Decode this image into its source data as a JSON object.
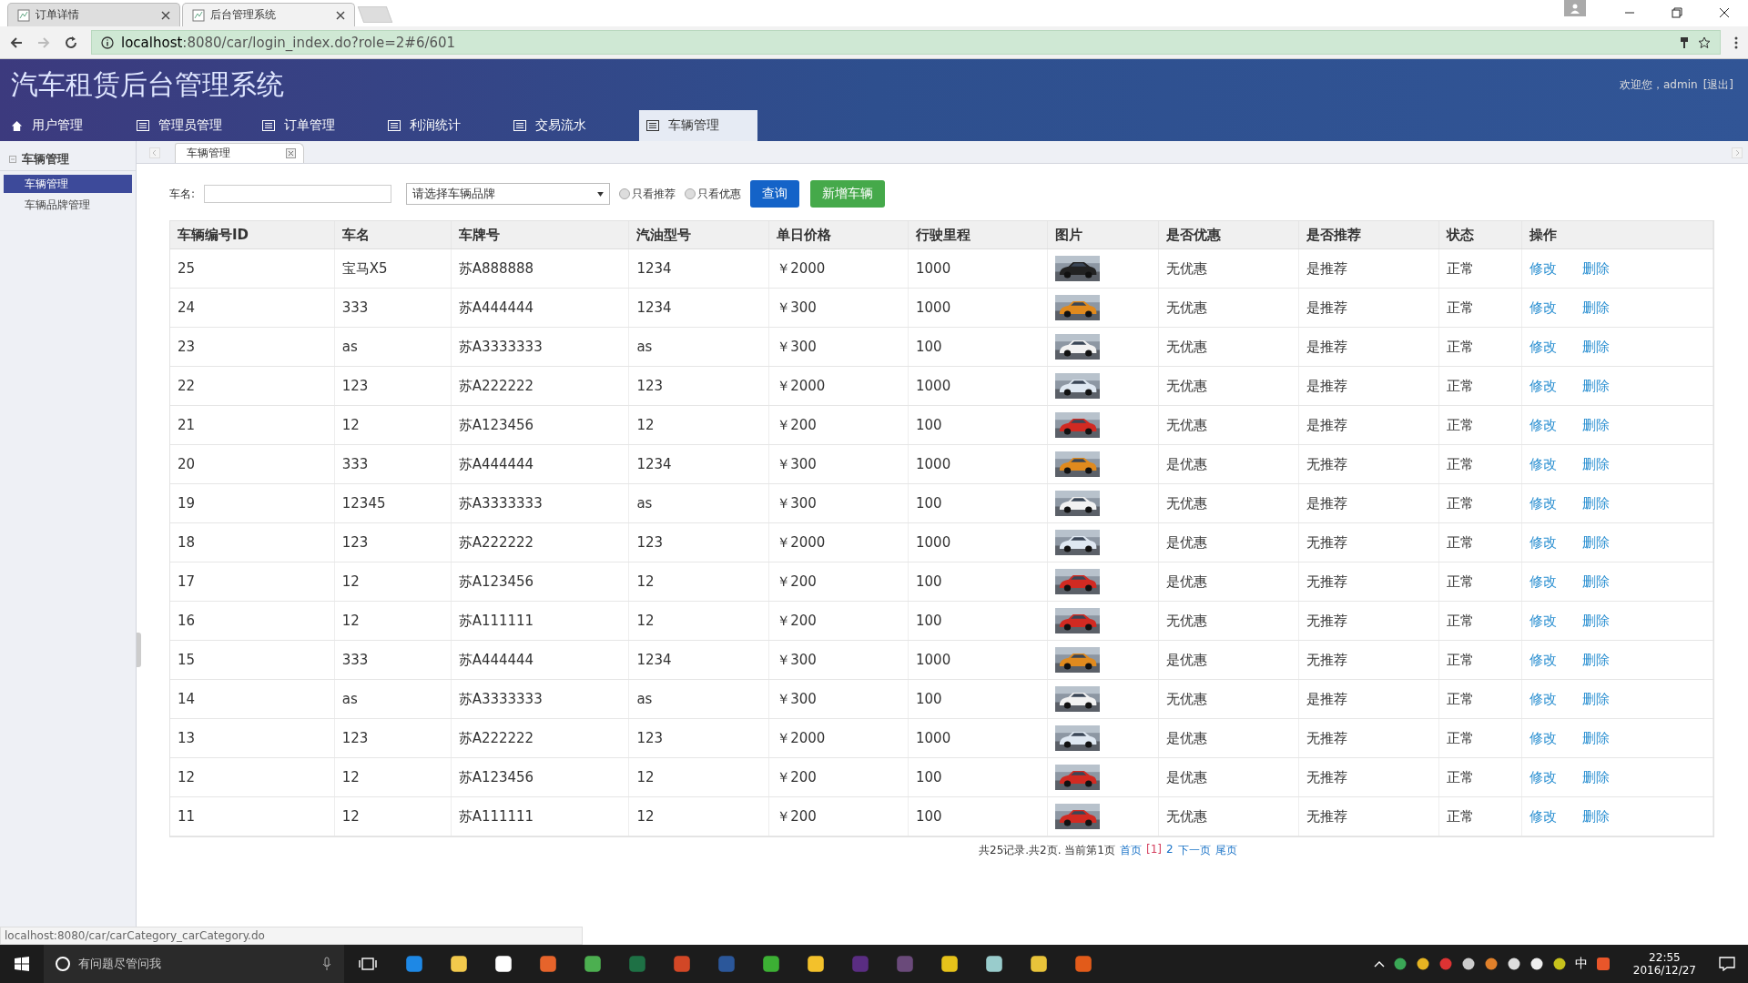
{
  "browser": {
    "tabs": [
      {
        "title": "订单详情",
        "selected": false
      },
      {
        "title": "后台管理系统",
        "selected": true
      }
    ],
    "url_host": "localhost",
    "url_rest": ":8080/car/login_index.do?role=2#6/601",
    "status_url": "localhost:8080/car/carCategory_carCategory.do"
  },
  "header": {
    "title": "汽车租赁后台管理系统",
    "greeting": "欢迎您，admin",
    "logout": "[退出]"
  },
  "nav": [
    {
      "label": "用户管理",
      "kind": "home",
      "selected": false
    },
    {
      "label": "管理员管理",
      "kind": "list",
      "selected": false
    },
    {
      "label": "订单管理",
      "kind": "list",
      "selected": false
    },
    {
      "label": "利润统计",
      "kind": "list",
      "selected": false
    },
    {
      "label": "交易流水",
      "kind": "list",
      "selected": false
    },
    {
      "label": "车辆管理",
      "kind": "list",
      "selected": true
    }
  ],
  "sidebar": {
    "group": "车辆管理",
    "items": [
      {
        "label": "车辆管理",
        "selected": true
      },
      {
        "label": "车辆品牌管理",
        "selected": false
      }
    ]
  },
  "content_tabs": [
    {
      "label": "车辆管理"
    }
  ],
  "filter": {
    "name_label": "车名:",
    "brand_select": "请选择车辆品牌",
    "radios": [
      {
        "label": "只看推荐",
        "checked": false
      },
      {
        "label": "只看优惠",
        "checked": false
      }
    ],
    "search_button": "查询",
    "add_button": "新增车辆"
  },
  "table": {
    "columns": [
      {
        "label": "车辆编号ID",
        "kind": "text"
      },
      {
        "label": "车名",
        "kind": "text"
      },
      {
        "label": "车牌号",
        "kind": "text"
      },
      {
        "label": "汽油型号",
        "kind": "text"
      },
      {
        "label": "单日价格",
        "kind": "text"
      },
      {
        "label": "行驶里程",
        "kind": "text"
      },
      {
        "label": "图片",
        "kind": "picture"
      },
      {
        "label": "是否优惠",
        "kind": "text"
      },
      {
        "label": "是否推荐",
        "kind": "text"
      },
      {
        "label": "状态",
        "kind": "text"
      },
      {
        "label": "操作",
        "kind": "actions"
      }
    ],
    "rows": [
      {
        "cells": [
          "25",
          "宝马X5",
          "苏A888888",
          "1234",
          "￥2000",
          "1000",
          "",
          "无优惠",
          "是推荐",
          "正常"
        ],
        "actions": [
          "修改",
          "删除"
        ]
      },
      {
        "cells": [
          "24",
          "333",
          "苏A444444",
          "1234",
          "￥300",
          "1000",
          "",
          "无优惠",
          "是推荐",
          "正常"
        ],
        "actions": [
          "修改",
          "删除"
        ]
      },
      {
        "cells": [
          "23",
          "as",
          "苏A3333333",
          "as",
          "￥300",
          "100",
          "",
          "无优惠",
          "是推荐",
          "正常"
        ],
        "actions": [
          "修改",
          "删除"
        ]
      },
      {
        "cells": [
          "22",
          "123",
          "苏A222222",
          "123",
          "￥2000",
          "1000",
          "",
          "无优惠",
          "是推荐",
          "正常"
        ],
        "actions": [
          "修改",
          "删除"
        ]
      },
      {
        "cells": [
          "21",
          "12",
          "苏A123456",
          "12",
          "￥200",
          "100",
          "",
          "无优惠",
          "是推荐",
          "正常"
        ],
        "actions": [
          "修改",
          "删除"
        ]
      },
      {
        "cells": [
          "20",
          "333",
          "苏A444444",
          "1234",
          "￥300",
          "1000",
          "",
          "是优惠",
          "无推荐",
          "正常"
        ],
        "actions": [
          "修改",
          "删除"
        ]
      },
      {
        "cells": [
          "19",
          "12345",
          "苏A3333333",
          "as",
          "￥300",
          "100",
          "",
          "无优惠",
          "是推荐",
          "正常"
        ],
        "actions": [
          "修改",
          "删除"
        ]
      },
      {
        "cells": [
          "18",
          "123",
          "苏A222222",
          "123",
          "￥2000",
          "1000",
          "",
          "是优惠",
          "无推荐",
          "正常"
        ],
        "actions": [
          "修改",
          "删除"
        ]
      },
      {
        "cells": [
          "17",
          "12",
          "苏A123456",
          "12",
          "￥200",
          "100",
          "",
          "是优惠",
          "无推荐",
          "正常"
        ],
        "actions": [
          "修改",
          "删除"
        ]
      },
      {
        "cells": [
          "16",
          "12",
          "苏A111111",
          "12",
          "￥200",
          "100",
          "",
          "无优惠",
          "无推荐",
          "正常"
        ],
        "actions": [
          "修改",
          "删除"
        ]
      },
      {
        "cells": [
          "15",
          "333",
          "苏A444444",
          "1234",
          "￥300",
          "1000",
          "",
          "是优惠",
          "无推荐",
          "正常"
        ],
        "actions": [
          "修改",
          "删除"
        ]
      },
      {
        "cells": [
          "14",
          "as",
          "苏A3333333",
          "as",
          "￥300",
          "100",
          "",
          "无优惠",
          "是推荐",
          "正常"
        ],
        "actions": [
          "修改",
          "删除"
        ]
      },
      {
        "cells": [
          "13",
          "123",
          "苏A222222",
          "123",
          "￥2000",
          "1000",
          "",
          "是优惠",
          "无推荐",
          "正常"
        ],
        "actions": [
          "修改",
          "删除"
        ]
      },
      {
        "cells": [
          "12",
          "12",
          "苏A123456",
          "12",
          "￥200",
          "100",
          "",
          "是优惠",
          "无推荐",
          "正常"
        ],
        "actions": [
          "修改",
          "删除"
        ]
      },
      {
        "cells": [
          "11",
          "12",
          "苏A111111",
          "12",
          "￥200",
          "100",
          "",
          "无优惠",
          "无推荐",
          "正常"
        ],
        "actions": [
          "修改",
          "删除"
        ]
      }
    ]
  },
  "pagination": {
    "summary": "共25记录.共2页. 当前第1页",
    "links": [
      {
        "label": "首页",
        "selected": false
      },
      {
        "label": "[1]",
        "selected": true
      },
      {
        "label": "2",
        "selected": false
      },
      {
        "label": "下一页",
        "selected": false
      },
      {
        "label": "尾页",
        "selected": false
      }
    ]
  },
  "taskbar": {
    "search_placeholder": "有问题尽管问我",
    "ime": "中",
    "time": "22:55",
    "date": "2016/12/27"
  }
}
